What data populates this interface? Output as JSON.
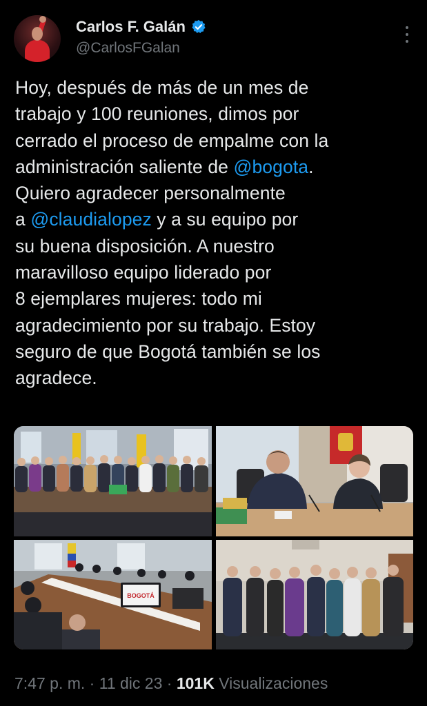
{
  "author": {
    "name": "Carlos F. Galán",
    "handle": "@CarlosFGalan",
    "verified": true,
    "avatar_icon": "profile-avatar"
  },
  "tweet": {
    "lines": [
      [
        {
          "t": "Hoy, después de más de un mes de"
        }
      ],
      [
        {
          "t": "trabajo y 100 reuniones, dimos por"
        }
      ],
      [
        {
          "t": "cerrado el proceso de empalme con la"
        }
      ],
      [
        {
          "t": "administración saliente de "
        },
        {
          "t": "@bogota",
          "mention": true
        },
        {
          "t": "."
        }
      ],
      [
        {
          "t": "Quiero agradecer personalmente"
        }
      ],
      [
        {
          "t": "a "
        },
        {
          "t": "@claudialopez",
          "mention": true
        },
        {
          "t": " y a su equipo por"
        }
      ],
      [
        {
          "t": "su buena disposición. A nuestro"
        }
      ],
      [
        {
          "t": "maravilloso equipo liderado por"
        }
      ],
      [
        {
          "t": "8 ejemplares mujeres: todo mi"
        }
      ],
      [
        {
          "t": "agradecimiento por su trabajo. Estoy"
        }
      ],
      [
        {
          "t": "seguro de que Bogotá también se los"
        }
      ],
      [
        {
          "t": "agradece."
        }
      ]
    ],
    "mention_color": "#1d9bf0"
  },
  "media": {
    "photos": [
      "group-photo-table",
      "meeting-two-people",
      "conference-room-meeting",
      "group-photo-standing"
    ],
    "visible_text": {
      "laptop_sign": "BOGOTÁ"
    }
  },
  "meta": {
    "time": "7:47 p. m.",
    "separator": " · ",
    "date": "11 dic 23",
    "views_count": "101K",
    "views_label": "Visualizaciones"
  },
  "colors": {
    "background": "#000000",
    "text": "#e7e9ea",
    "secondary": "#71767b",
    "accent": "#1d9bf0"
  }
}
